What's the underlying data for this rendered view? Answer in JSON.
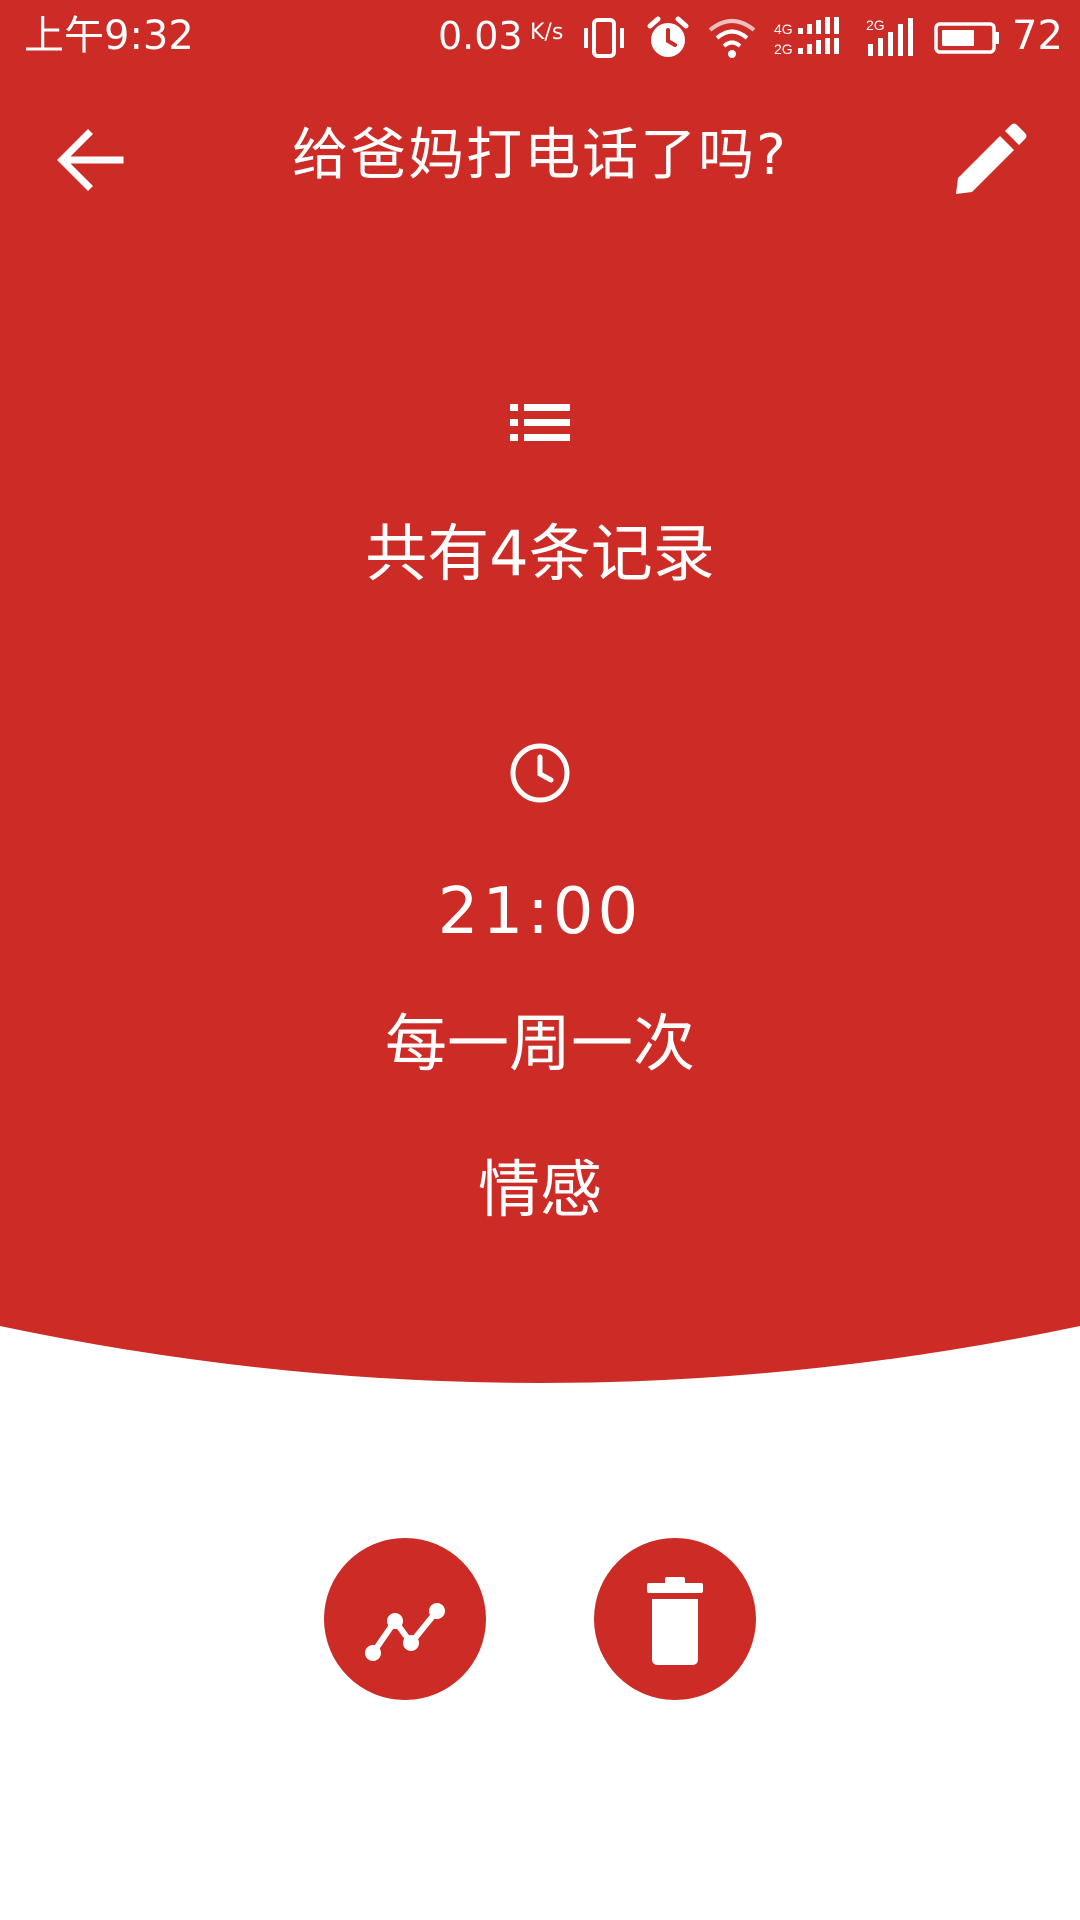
{
  "colors": {
    "primary": "#cc2b26",
    "on_primary": "#ffffff",
    "background": "#ffffff"
  },
  "status_bar": {
    "time": "上午9:32",
    "network_speed": "0.03",
    "network_speed_unit": "K/s",
    "battery_level": "72",
    "icons": [
      "vibrate-icon",
      "alarm-icon",
      "wifi-icon",
      "signal-4g-2g-icon",
      "signal-2g-icon",
      "battery-icon"
    ]
  },
  "toolbar": {
    "title": "给爸妈打电话了吗?",
    "back_icon": "arrow-back-icon",
    "edit_icon": "pencil-edit-icon"
  },
  "task": {
    "records_icon": "list-icon",
    "record_count_text": "共有4条记录",
    "time_icon": "clock-icon",
    "reminder_time": "21:00",
    "repeat": "每一周一次",
    "category": "情感"
  },
  "actions": {
    "stats_icon": "line-chart-icon",
    "delete_icon": "trash-icon"
  }
}
